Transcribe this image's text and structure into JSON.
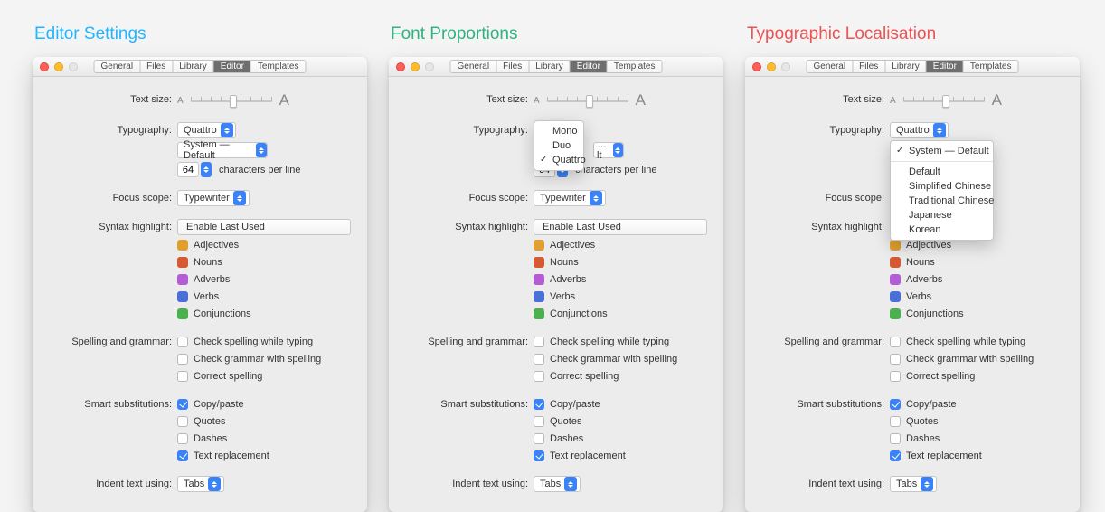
{
  "panels": [
    {
      "title": "Editor Settings",
      "color": "#1fb6ff"
    },
    {
      "title": "Font Proportions",
      "color": "#2fb380"
    },
    {
      "title": "Typographic Localisation",
      "color": "#ee5253"
    }
  ],
  "toolbar": {
    "tabs": [
      "General",
      "Files",
      "Library",
      "Editor",
      "Templates"
    ],
    "active": "Editor"
  },
  "labels": {
    "text_size": "Text size:",
    "typography": "Typography:",
    "chars_per_line": "characters per line",
    "focus_scope": "Focus scope:",
    "syntax_highlight": "Syntax highlight:",
    "spelling": "Spelling and grammar:",
    "smart_subs": "Smart substitutions:",
    "indent": "Indent text using:"
  },
  "values": {
    "typography": "Quattro",
    "system_default": "System — Default",
    "cpl": "64",
    "focus_scope": "Typewriter",
    "enable_last_used": "Enable Last Used",
    "indent": "Tabs"
  },
  "syntax": [
    {
      "label": "Adjectives",
      "color": "#e0a030"
    },
    {
      "label": "Nouns",
      "color": "#d65a31"
    },
    {
      "label": "Adverbs",
      "color": "#b45bd6"
    },
    {
      "label": "Verbs",
      "color": "#4a6fd6"
    },
    {
      "label": "Conjunctions",
      "color": "#4caf50"
    }
  ],
  "spelling_opts": [
    {
      "label": "Check spelling while typing",
      "checked": false
    },
    {
      "label": "Check grammar with spelling",
      "checked": false
    },
    {
      "label": "Correct spelling",
      "checked": false
    }
  ],
  "smart_opts": [
    {
      "label": "Copy/paste",
      "checked": true
    },
    {
      "label": "Quotes",
      "checked": false
    },
    {
      "label": "Dashes",
      "checked": false
    },
    {
      "label": "Text replacement",
      "checked": true
    }
  ],
  "typography_menu": {
    "items": [
      "Mono",
      "Duo",
      "Quattro"
    ]
  },
  "locale_menu": {
    "selected": "System — Default",
    "items": [
      "Default",
      "Simplified Chinese",
      "Traditional Chinese",
      "Japanese",
      "Korean"
    ]
  }
}
